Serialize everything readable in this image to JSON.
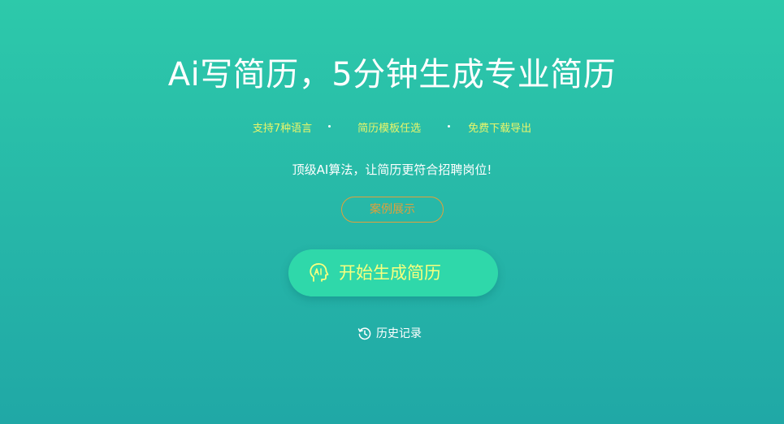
{
  "hero": {
    "title": "Ai写简历，5分钟生成专业简历",
    "features": [
      "支持7种语言",
      "简历模板任选",
      "免费下载导出"
    ],
    "subtitle": "顶级AI算法，让简历更符合招聘岗位!",
    "case_button_label": "案例展示",
    "start_button_label": "开始生成简历",
    "history_link_label": "历史记录"
  },
  "icons": {
    "start": "ai-head-icon",
    "history": "history-clock-icon"
  },
  "colors": {
    "background_top": "#2dc9aa",
    "background_bottom": "#20a8a6",
    "feature_text": "#e9f56a",
    "case_button_accent": "#e2a03a",
    "start_button_bg": "#2fd8aa",
    "start_button_text": "#f7ff7e"
  }
}
